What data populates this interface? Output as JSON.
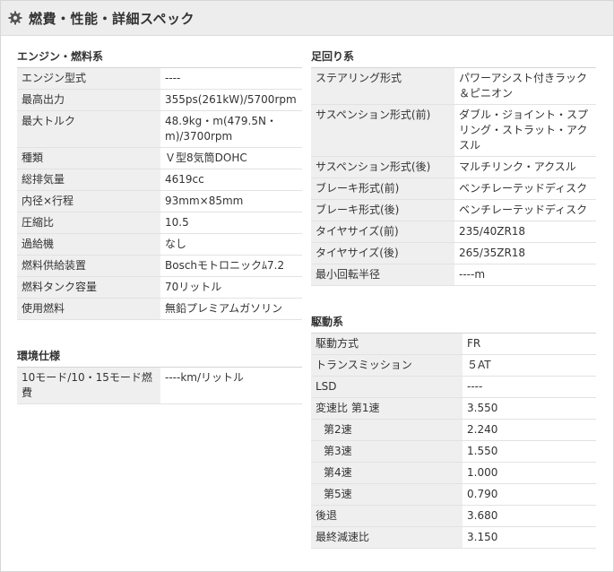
{
  "header": {
    "title": "燃費・性能・詳細スペック",
    "icon": "gear-icon"
  },
  "engine": {
    "title": "エンジン・燃料系",
    "rows": [
      {
        "k": "エンジン型式",
        "v": "----"
      },
      {
        "k": "最高出力",
        "v": "355ps(261kW)/5700rpm"
      },
      {
        "k": "最大トルク",
        "v": "48.9kg・m(479.5N・m)/3700rpm"
      },
      {
        "k": "種類",
        "v": "Ｖ型8気筒DOHC"
      },
      {
        "k": "総排気量",
        "v": "4619cc"
      },
      {
        "k": "内径×行程",
        "v": "93mm×85mm"
      },
      {
        "k": "圧縮比",
        "v": "10.5"
      },
      {
        "k": "過給機",
        "v": "なし"
      },
      {
        "k": "燃料供給装置",
        "v": "Boschモトロニックﾑ7.2"
      },
      {
        "k": "燃料タンク容量",
        "v": "70リットル"
      },
      {
        "k": "使用燃料",
        "v": "無鉛プレミアムガソリン"
      }
    ]
  },
  "environment": {
    "title": "環境仕様",
    "rows": [
      {
        "k": "10モード/10・15モード燃費",
        "v": "----km/リットル"
      }
    ]
  },
  "suspension": {
    "title": "足回り系",
    "rows": [
      {
        "k": "ステアリング形式",
        "v": "パワーアシスト付きラック＆ピニオン"
      },
      {
        "k": "サスペンション形式(前)",
        "v": "ダブル・ジョイント・スプリング・ストラット・アクスル"
      },
      {
        "k": "サスペンション形式(後)",
        "v": "マルチリンク・アクスル"
      },
      {
        "k": "ブレーキ形式(前)",
        "v": "ベンチレーテッドディスク"
      },
      {
        "k": "ブレーキ形式(後)",
        "v": "ベンチレーテッドディスク"
      },
      {
        "k": "タイヤサイズ(前)",
        "v": "235/40ZR18"
      },
      {
        "k": "タイヤサイズ(後)",
        "v": "265/35ZR18"
      },
      {
        "k": "最小回転半径",
        "v": "----m"
      }
    ]
  },
  "drive": {
    "title": "駆動系",
    "rows": [
      {
        "k": "駆動方式",
        "v": "FR"
      },
      {
        "k": "トランスミッション",
        "v": "５AT"
      },
      {
        "k": "LSD",
        "v": "----"
      },
      {
        "k": "変速比 第1速",
        "v": "3.550"
      },
      {
        "k": "第2速",
        "v": "2.240"
      },
      {
        "k": "第3速",
        "v": "1.550"
      },
      {
        "k": "第4速",
        "v": "1.000"
      },
      {
        "k": "第5速",
        "v": "0.790"
      },
      {
        "k": "後退",
        "v": "3.680"
      },
      {
        "k": "最終減速比",
        "v": "3.150"
      }
    ]
  }
}
